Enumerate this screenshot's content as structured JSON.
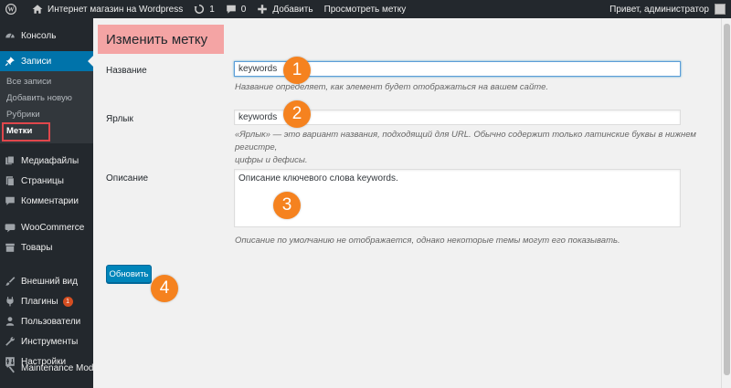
{
  "admin_bar": {
    "site_name": "Интернет магазин на Wordpress",
    "updates_count": "1",
    "comments_count": "0",
    "add_new": "Добавить",
    "view_tag": "Просмотреть метку",
    "greeting": "Привет, администратор"
  },
  "sidebar": {
    "console": "Консоль",
    "posts": "Записи",
    "submenu": [
      "Все записи",
      "Добавить новую",
      "Рубрики",
      "Метки"
    ],
    "media": "Медиафайлы",
    "pages": "Страницы",
    "comments": "Комментарии",
    "woocommerce": "WooCommerce",
    "products": "Товары",
    "appearance": "Внешний вид",
    "plugins": "Плагины",
    "plugins_badge": "1",
    "users": "Пользователи",
    "tools": "Инструменты",
    "settings": "Настройки",
    "maintenance": "Maintenance Mode"
  },
  "page": {
    "title": "Изменить метку",
    "name_label": "Название",
    "name_value": "keywords",
    "name_desc": "Название определяет, как элемент будет отображаться на вашем сайте.",
    "slug_label": "Ярлык",
    "slug_value": "keywords",
    "slug_desc_1": "«Ярлык» — это вариант названия, подходящий для URL. Обычно содержит только латинские буквы в нижнем регистре,",
    "slug_desc_2": "цифры и дефисы.",
    "description_label": "Описание",
    "description_value": "Описание ключевого слова keywords.",
    "description_desc": "Описание по умолчанию не отображается, однако некоторые темы могут его показывать.",
    "update_button": "Обновить"
  },
  "markers": [
    "1",
    "2",
    "3",
    "4"
  ],
  "colors": {
    "admin_bg": "#23282d",
    "accent": "#0073aa",
    "button": "#0085ba",
    "marker": "#f5821f",
    "title_highlight": "#f4a4a4",
    "submenu_outline": "#e0474c"
  }
}
